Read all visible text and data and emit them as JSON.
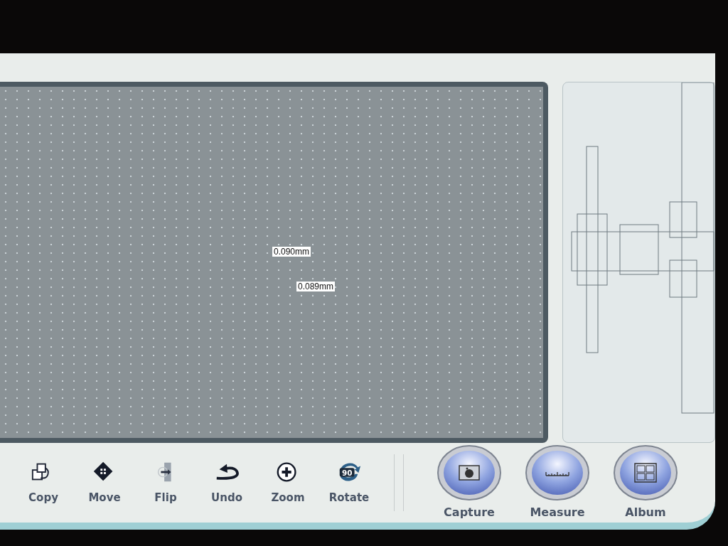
{
  "measurements": [
    {
      "label": "0.090mm"
    },
    {
      "label": "0.089mm"
    }
  ],
  "tools": [
    {
      "label": "Copy",
      "kind": "copy"
    },
    {
      "label": "Move",
      "kind": "move"
    },
    {
      "label": "Flip",
      "kind": "flip"
    },
    {
      "label": "Undo",
      "kind": "undo"
    },
    {
      "label": "Zoom",
      "kind": "zoom"
    },
    {
      "label": "Rotate",
      "kind": "rotate",
      "badge": "90"
    }
  ],
  "actions": [
    {
      "label": "Capture",
      "kind": "capture"
    },
    {
      "label": "Measure",
      "kind": "measure"
    },
    {
      "label": "Album",
      "kind": "album"
    }
  ]
}
